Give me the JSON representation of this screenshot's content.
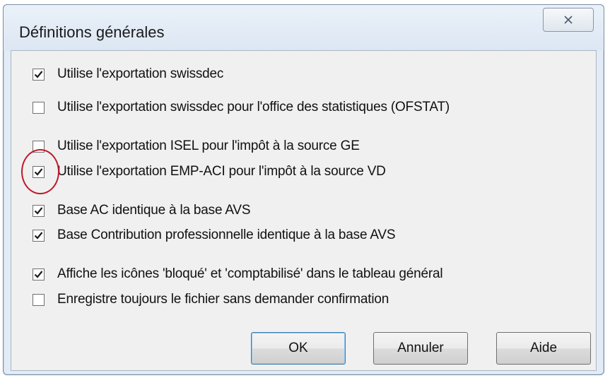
{
  "dialog": {
    "title": "Définitions générales",
    "close_label": "☒"
  },
  "options": [
    {
      "label": "Utilise l'exportation swissdec",
      "checked": true
    },
    {
      "label": "Utilise l'exportation swissdec pour l'office des statistiques (OFSTAT)",
      "checked": false
    },
    {
      "label": "Utilise l'exportation ISEL pour l'impôt à la source GE",
      "checked": false
    },
    {
      "label": "Utilise l'exportation EMP-ACI pour l'impôt à la source VD",
      "checked": true
    },
    {
      "label": "Base AC identique à la base AVS",
      "checked": true
    },
    {
      "label": "Base Contribution professionnelle identique à la base AVS",
      "checked": true
    },
    {
      "label": "Affiche les icônes 'bloqué' et 'comptabilisé' dans le tableau général",
      "checked": true
    },
    {
      "label": "Enregistre toujours le fichier sans demander confirmation",
      "checked": false
    }
  ],
  "buttons": {
    "ok": "OK",
    "cancel": "Annuler",
    "help": "Aide"
  },
  "colors": {
    "annotation_circle": "#c0182a"
  }
}
